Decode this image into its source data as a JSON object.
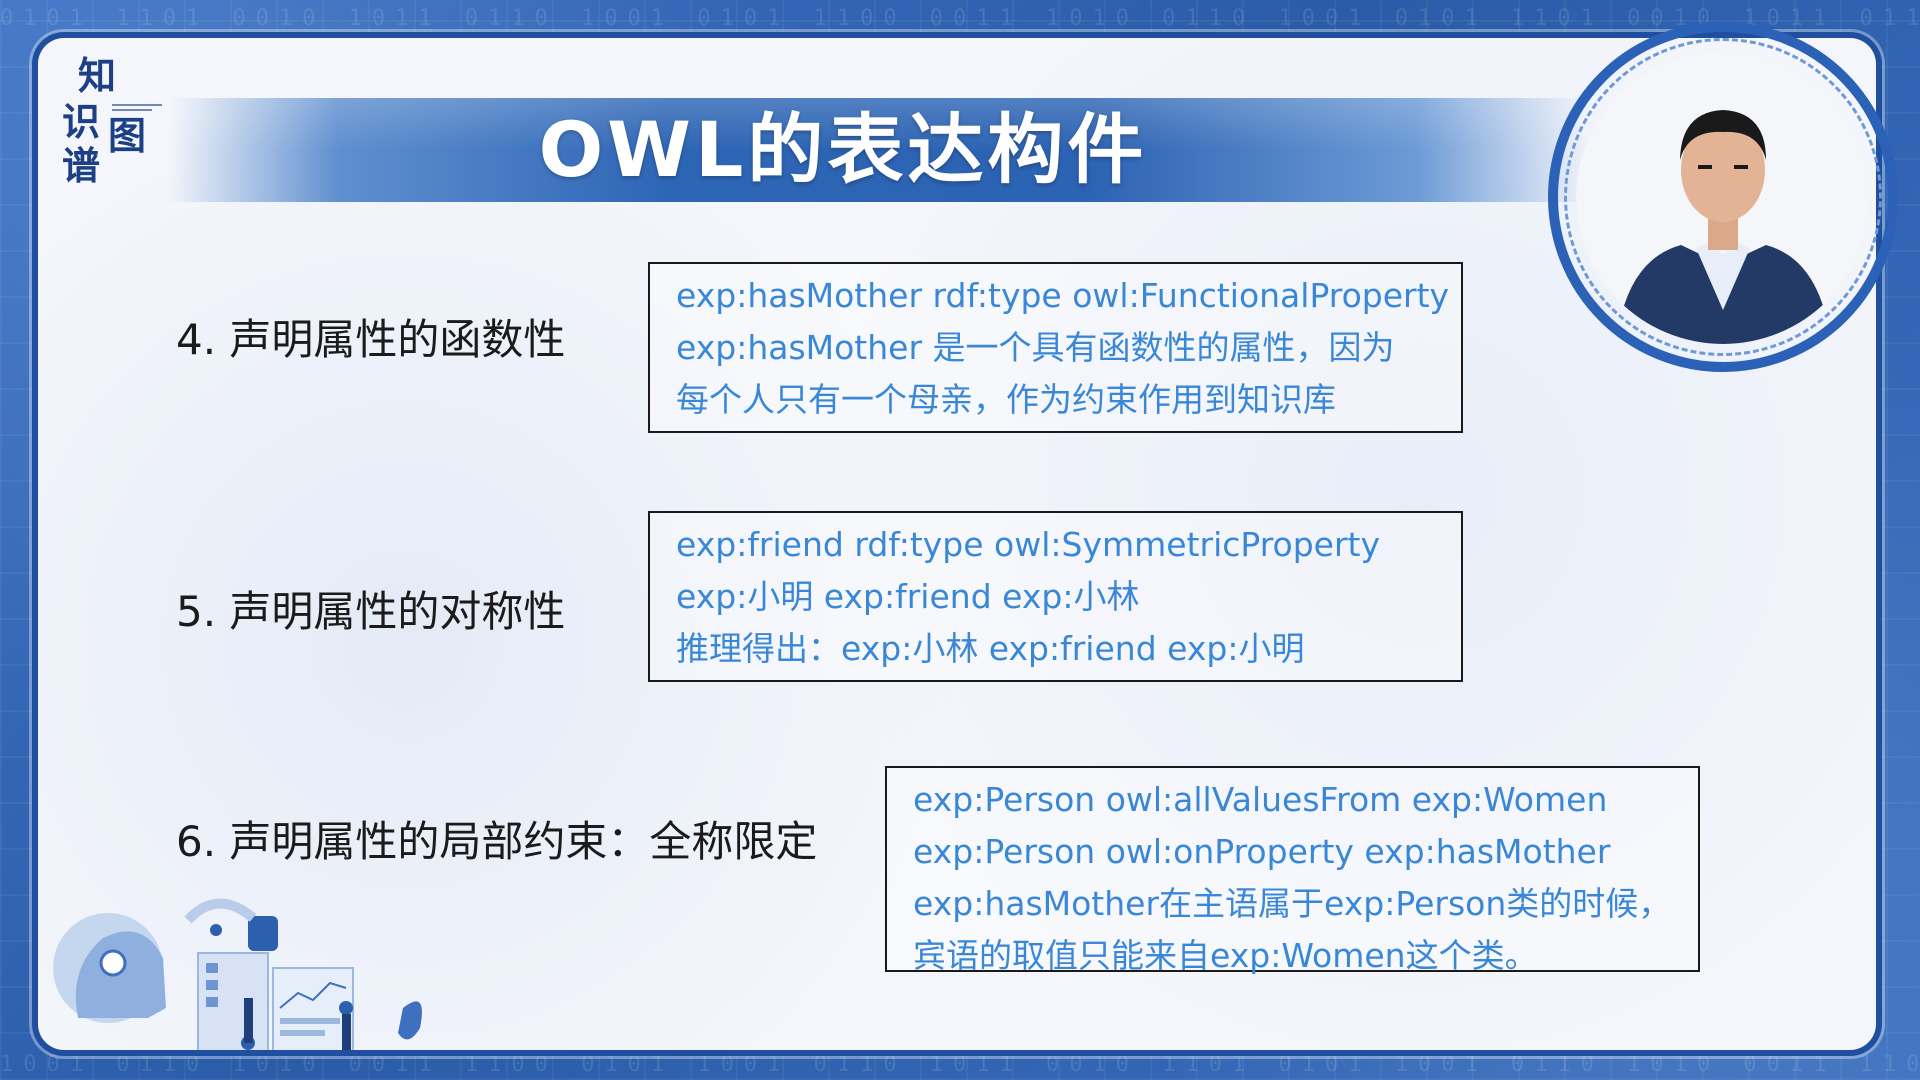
{
  "logo": {
    "chars": [
      "知",
      "识",
      "图",
      "谱"
    ]
  },
  "title": "OWL的表达构件",
  "items": [
    {
      "label": "4. 声明属性的函数性",
      "lines": [
        "exp:hasMother rdf:type owl:FunctionalProperty",
        "exp:hasMother 是一个具有函数性的属性，因为",
        "每个人只有一个母亲，作为约束作用到知识库"
      ]
    },
    {
      "label": "5. 声明属性的对称性",
      "lines": [
        "exp:friend rdf:type owl:SymmetricProperty",
        "exp:小明 exp:friend exp:小林",
        "推理得出：exp:小林 exp:friend exp:小明"
      ]
    },
    {
      "label": "6. 声明属性的局部约束：全称限定",
      "lines": [
        "exp:Person owl:allValuesFrom exp:Women",
        "exp:Person owl:onProperty exp:hasMother",
        "exp:hasMother在主语属于exp:Person类的时候，",
        "宾语的取值只能来自exp:Women这个类。"
      ]
    }
  ],
  "colors": {
    "frame_blue": "#2f63b4",
    "title_banner": "#2c63b3",
    "box_text": "#3a87d8",
    "label_text": "#1b1b1b"
  },
  "icons": [
    "presenter-video",
    "robot-illustration"
  ]
}
